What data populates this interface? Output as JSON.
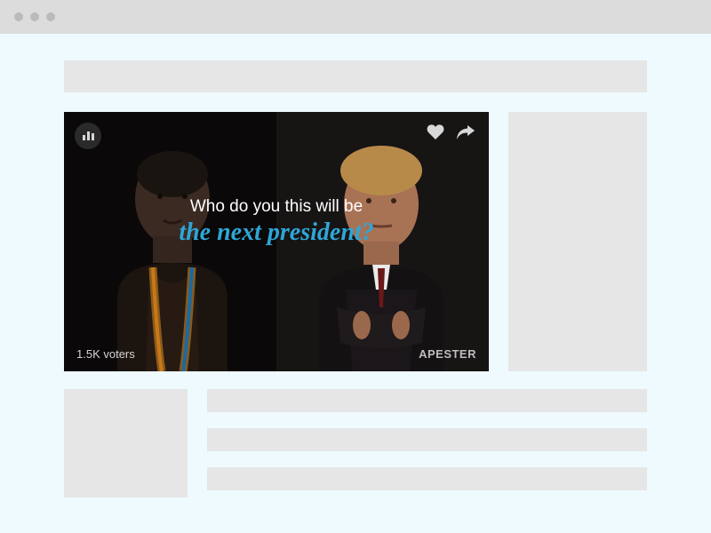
{
  "poll": {
    "question_line1": "Who do you this will be",
    "question_line2": "the next president?",
    "voters_label": "1.5K voters",
    "brand_label": "APESTER",
    "icons": {
      "poll_type": "poll-bars-icon",
      "like": "heart-icon",
      "share": "share-icon"
    }
  }
}
